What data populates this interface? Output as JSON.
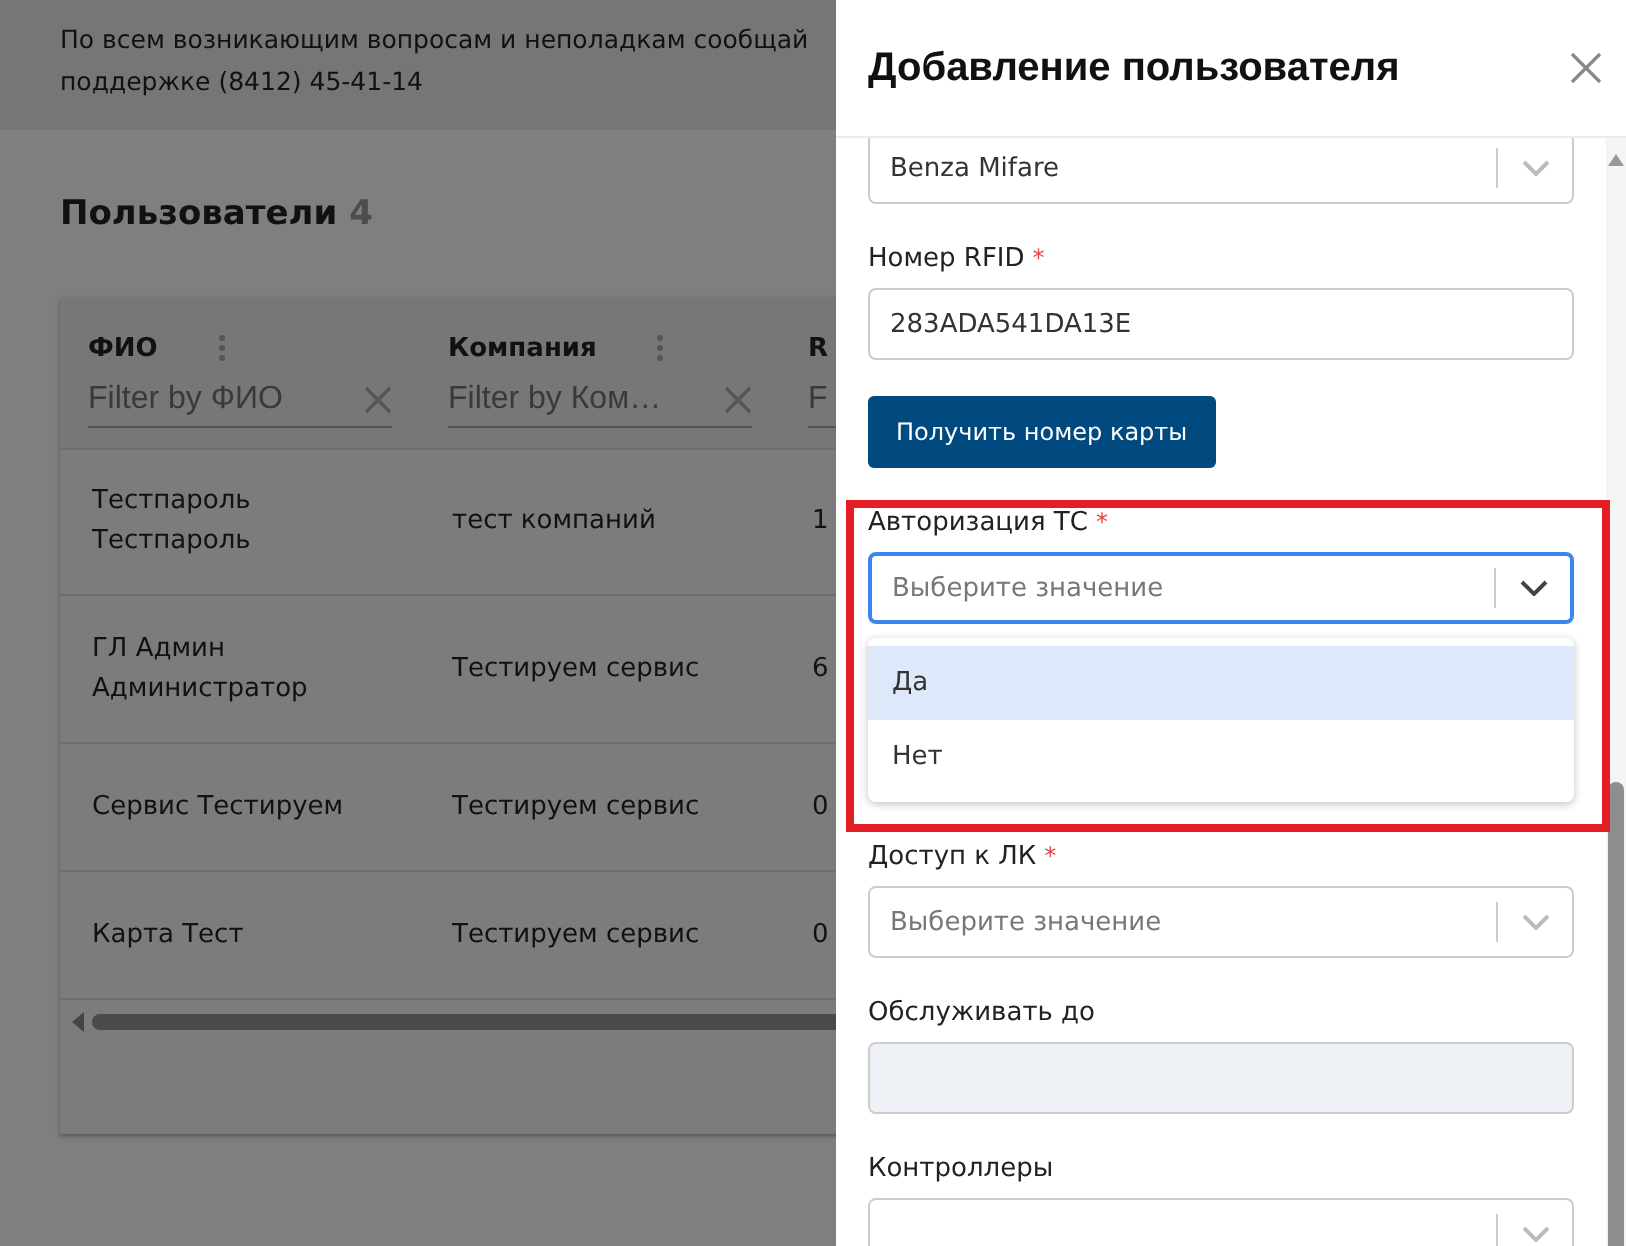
{
  "banner": {
    "lines": [
      "По всем возникающим вопросам и неполадкам сообщай",
      "поддержке (8412) 45-41-14"
    ]
  },
  "users": {
    "title": "Пользователи",
    "count": "4",
    "table": {
      "columns": [
        {
          "label": "ФИО",
          "filter_placeholder": "Filter by ФИО",
          "clear_icon": true
        },
        {
          "label": "Компания",
          "filter_placeholder": "Filter by Ком…",
          "clear_icon": true
        },
        {
          "label": "R",
          "filter_placeholder": "F"
        }
      ],
      "rows": [
        [
          "Тестпароль Тестпароль",
          "тест компаний",
          "1"
        ],
        [
          "ГЛ Админ Администратор",
          "Тестируем сервис",
          "6"
        ],
        [
          "Сервис Тестируем",
          "Тестируем сервис",
          "0"
        ],
        [
          "Карта Тест",
          "Тестируем сервис",
          "0"
        ]
      ]
    }
  },
  "drawer": {
    "title": "Добавление пользователя",
    "fields": [
      {
        "kind": "select",
        "value": "Benza Mifare"
      },
      {
        "kind": "text",
        "label": "Номер RFID",
        "required_mark": "*",
        "value": "283ADA541DA13E"
      },
      {
        "kind": "button",
        "label": "Получить номер карты"
      },
      {
        "kind": "select",
        "label": "Авторизация ТС",
        "required_mark": "*",
        "placeholder": "Выберите значение",
        "focused": true,
        "options": [
          {
            "label": "Да",
            "selected": true
          },
          {
            "label": "Нет",
            "selected": false
          }
        ]
      },
      {
        "kind": "select",
        "label": "Доступ к ЛК",
        "required_mark": "*",
        "placeholder": "Выберите значение"
      },
      {
        "kind": "text",
        "label": "Обслуживать до",
        "disabled": true
      },
      {
        "kind": "select",
        "label": "Контроллеры"
      }
    ]
  }
}
